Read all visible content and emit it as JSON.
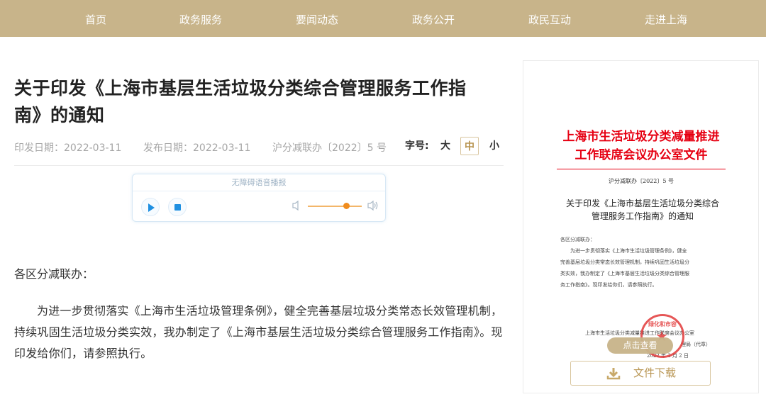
{
  "nav": {
    "items": [
      "首页",
      "政务服务",
      "要闻动态",
      "政务公开",
      "政民互动",
      "走进上海"
    ]
  },
  "article": {
    "title_line1": "关于印发《上海市基层生活垃圾分类综合管理服务工作指",
    "title_line2": "南》的通知",
    "issue_date": "印发日期：2022-03-11",
    "publish_date": "发布日期：2022-03-11",
    "doc_number": "沪分减联办〔2022〕5 号",
    "font_size_label": "字号:",
    "font_sizes": [
      "大",
      "中",
      "小"
    ],
    "salutation": "各区分减联办：",
    "paragraph": "为进一步贯彻落实《上海市生活垃圾管理条例》，健全完善基层垃圾分类常态长效管理机制，持续巩固生活垃圾分类实效，我办制定了《上海市基层生活垃圾分类综合管理服务工作指南》。现印发给你们，请参照执行。"
  },
  "player": {
    "title": "无障碍语音播报",
    "volume_level_fraction": 0.72
  },
  "doc_preview": {
    "header_line1": "上海市生活垃圾分类减量推进",
    "header_line2": "工作联席会议办公室文件",
    "number": "沪分减联办〔2022〕5 号",
    "title_line1": "关于印发《上海市基层生活垃圾分类综合",
    "title_line2": "管理服务工作指南》的通知",
    "salutation": "各区分减联办：",
    "body_lines": [
      "为进一步贯彻落实《上海市生活垃圾管理条例》，健全",
      "完善基层垃圾分类常态长效管理机制，持续巩固生活垃圾分",
      "类实效，我办制定了《上海市基层生活垃圾分类综合管理服",
      "务工作指南》。现印发给你们，请参照执行。"
    ],
    "sign_line1": "上海市生活垃圾分类减量推进工作联席会议办公室",
    "sign_line2": "理局（代章）",
    "sign_date": "2022 年 3 月 2 日",
    "seal_text": "绿化和市容",
    "view_button": "点击查看",
    "download_button": "文件下载"
  },
  "colors": {
    "nav_bg": "#c8b48a",
    "accent_gold": "#b89552",
    "doc_red": "#e60012",
    "player_blue": "#1e8fe1",
    "volume_orange": "#f08c1e"
  }
}
